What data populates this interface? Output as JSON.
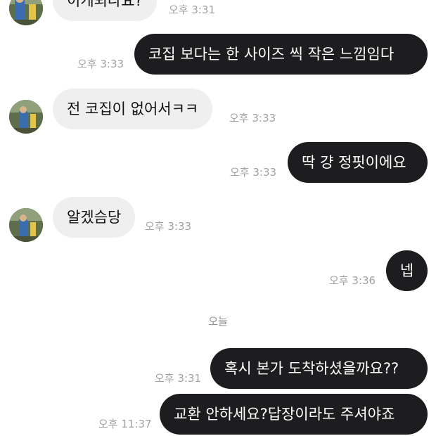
{
  "conversation": {
    "messages": [
      {
        "direction": "in",
        "text": "이게되나요?",
        "time": "오후 3:31"
      },
      {
        "direction": "out",
        "text": "코집 보다는 한 사이즈 씩 작은 느낌임다",
        "time": "오후 3:33"
      },
      {
        "direction": "in",
        "text": "전 코집이 없어서ㅋㅋ",
        "time": "오후 3:33"
      },
      {
        "direction": "out",
        "text": "딱 걍 정핏이에요",
        "time": "오후 3:33"
      },
      {
        "direction": "in",
        "text": "알겠슴당",
        "time": "오후 3:33"
      },
      {
        "direction": "out",
        "text": "넵",
        "time": "오후 3:36"
      },
      {
        "direction": "out",
        "text": "혹시 본가 도착하셨을까요??",
        "time": "오후 3:31"
      },
      {
        "direction": "out",
        "text": "교환 안하세요?답장이라도 주셔야죠",
        "time": "오후 11:37"
      }
    ],
    "day_divider": "오늘"
  },
  "colors": {
    "incoming_bubble": "#efefef",
    "outgoing_bubble": "#1d1d1f",
    "timestamp": "#a1a1a1"
  },
  "icons": {
    "avatar": "user-avatar-photo"
  }
}
